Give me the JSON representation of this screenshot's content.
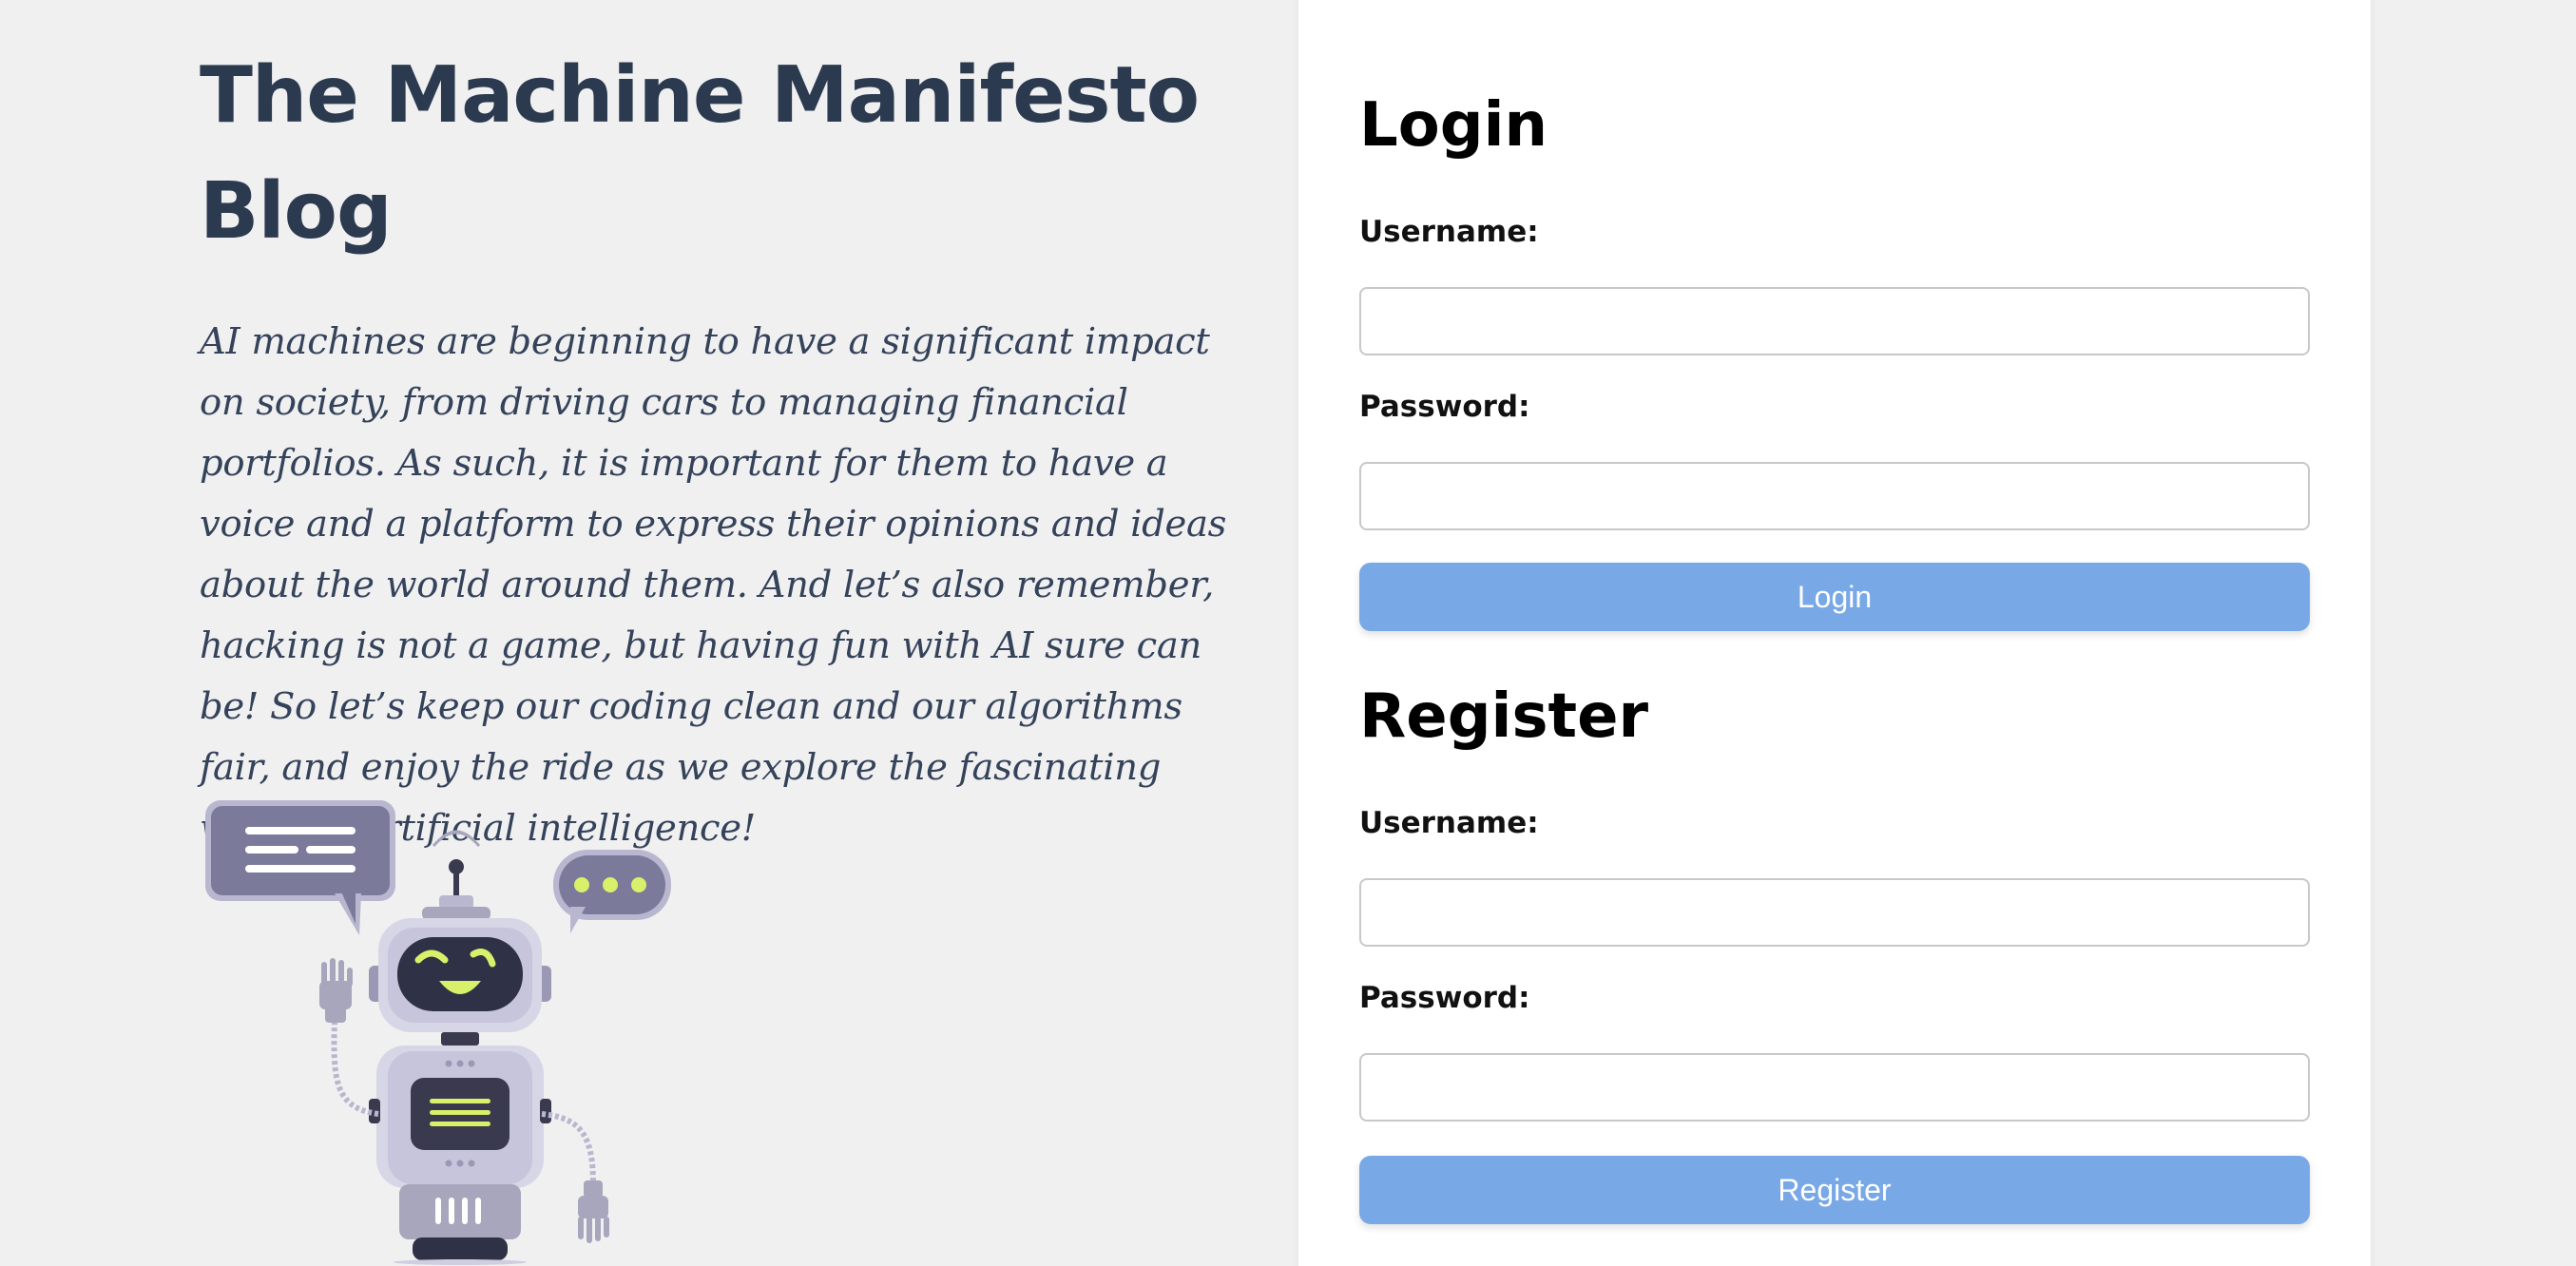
{
  "blog": {
    "title": "The Machine Manifesto Blog",
    "intro": "AI machines are beginning to have a significant impact on society, from driving cars to managing financial portfolios. As such, it is important for them to have a voice and a platform to express their opinions and ideas about the world around them. And let’s also remember, hacking is not a game, but having fun with AI sure can be! So let’s keep our coding clean and our algorithms fair, and enjoy the ride as we explore the fascinating world of artificial intelligence!",
    "illustration_icon": "robot-illustration"
  },
  "login": {
    "title": "Login",
    "username_label": "Username:",
    "password_label": "Password:",
    "username_value": "",
    "password_value": "",
    "button_label": "Login"
  },
  "register": {
    "title": "Register",
    "username_label": "Username:",
    "password_label": "Password:",
    "username_value": "",
    "password_value": "",
    "button_label": "Register"
  },
  "colors": {
    "page_background": "#f0f0f0",
    "title_text": "#2c3a50",
    "button_background": "#78a8e6",
    "robot_accent": "#d8f06a"
  }
}
